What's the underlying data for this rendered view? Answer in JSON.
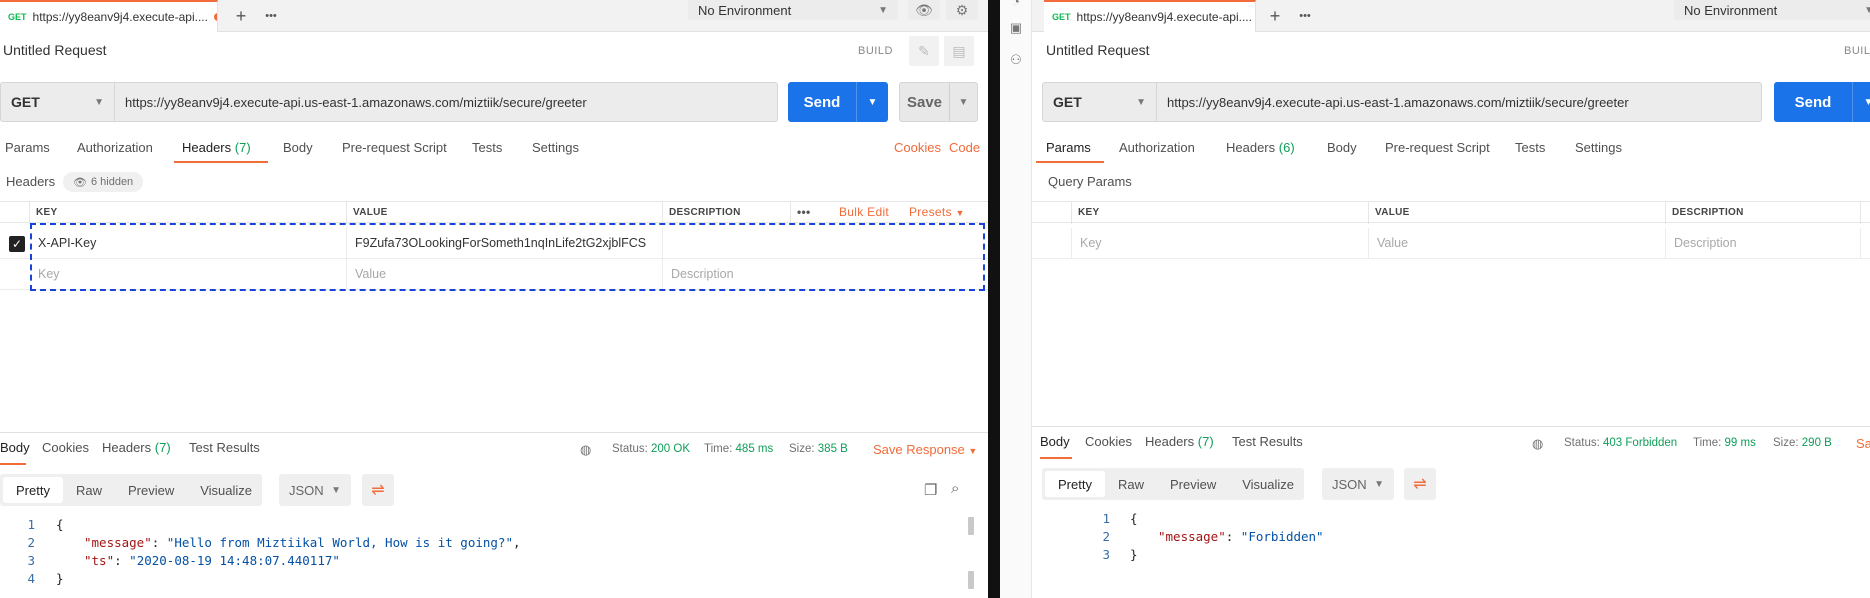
{
  "left": {
    "tab": {
      "method": "GET",
      "title": "https://yy8eanv9j4.execute-api...."
    },
    "new_tab_icon": "+",
    "more_icon": "•••",
    "environment": "No Environment",
    "request_title": "Untitled Request",
    "build_label": "BUILD",
    "method": "GET",
    "url": "https://yy8eanv9j4.execute-api.us-east-1.amazonaws.com/miztiik/secure/greeter",
    "send_label": "Send",
    "save_label": "Save",
    "tabs": [
      {
        "label": "Params"
      },
      {
        "label": "Authorization"
      },
      {
        "label": "Headers",
        "count": "(7)"
      },
      {
        "label": "Body"
      },
      {
        "label": "Pre-request Script"
      },
      {
        "label": "Tests"
      },
      {
        "label": "Settings"
      }
    ],
    "cookies_link": "Cookies",
    "code_link": "Code",
    "section_label": "Headers",
    "hidden_badge": "6 hidden",
    "table": {
      "columns": [
        "KEY",
        "VALUE",
        "DESCRIPTION"
      ],
      "more_icon": "•••",
      "bulk_edit": "Bulk Edit",
      "presets": "Presets",
      "rows": [
        {
          "checked": true,
          "key": "X-API-Key",
          "value": "F9Zufa73OLookingForSometh1nqInLife2tG2xjblFCS",
          "description": ""
        }
      ],
      "placeholder": {
        "key": "Key",
        "value": "Value",
        "description": "Description"
      }
    },
    "response": {
      "tabs": [
        {
          "label": "Body"
        },
        {
          "label": "Cookies"
        },
        {
          "label": "Headers",
          "count": "(7)"
        },
        {
          "label": "Test Results"
        }
      ],
      "status_label": "Status:",
      "status_value": "200 OK",
      "time_label": "Time:",
      "time_value": "485 ms",
      "size_label": "Size:",
      "size_value": "385 B",
      "save_response": "Save Response",
      "views": [
        "Pretty",
        "Raw",
        "Preview",
        "Visualize"
      ],
      "format": "JSON",
      "lines": [
        "1",
        "2",
        "3",
        "4"
      ],
      "code": {
        "open": "{",
        "message_key": "\"message\"",
        "message_val": "\"Hello from Miztiikal World, How is it going?\"",
        "ts_key": "\"ts\"",
        "ts_val": "\"2020-08-19 14:48:07.440117\"",
        "close": "}"
      }
    }
  },
  "right": {
    "tab": {
      "method": "GET",
      "title": "https://yy8eanv9j4.execute-api...."
    },
    "new_tab_icon": "+",
    "more_icon": "•••",
    "environment": "No Environment",
    "request_title": "Untitled Request",
    "build_label": "BUIL",
    "method": "GET",
    "url": "https://yy8eanv9j4.execute-api.us-east-1.amazonaws.com/miztiik/secure/greeter",
    "send_label": "Send",
    "tabs": [
      {
        "label": "Params"
      },
      {
        "label": "Authorization"
      },
      {
        "label": "Headers",
        "count": "(6)"
      },
      {
        "label": "Body"
      },
      {
        "label": "Pre-request Script"
      },
      {
        "label": "Tests"
      },
      {
        "label": "Settings"
      }
    ],
    "section_label": "Query Params",
    "table": {
      "columns": [
        "KEY",
        "VALUE",
        "DESCRIPTION"
      ],
      "placeholder": {
        "key": "Key",
        "value": "Value",
        "description": "Description"
      }
    },
    "response": {
      "tabs": [
        {
          "label": "Body"
        },
        {
          "label": "Cookies"
        },
        {
          "label": "Headers",
          "count": "(7)"
        },
        {
          "label": "Test Results"
        }
      ],
      "status_label": "Status:",
      "status_value": "403 Forbidden",
      "time_label": "Time:",
      "time_value": "99 ms",
      "size_label": "Size:",
      "size_value": "290 B",
      "save_response": "Sa",
      "views": [
        "Pretty",
        "Raw",
        "Preview",
        "Visualize"
      ],
      "format": "JSON",
      "lines": [
        "1",
        "2",
        "3"
      ],
      "code": {
        "open": "{",
        "message_key": "\"message\"",
        "message_val": "\"Forbidden\"",
        "close": "}"
      }
    }
  },
  "colors": {
    "accent": "#f26b3a",
    "send": "#1a73e8",
    "success": "#0f9d58",
    "highlight_dash": "#1a44d8"
  }
}
